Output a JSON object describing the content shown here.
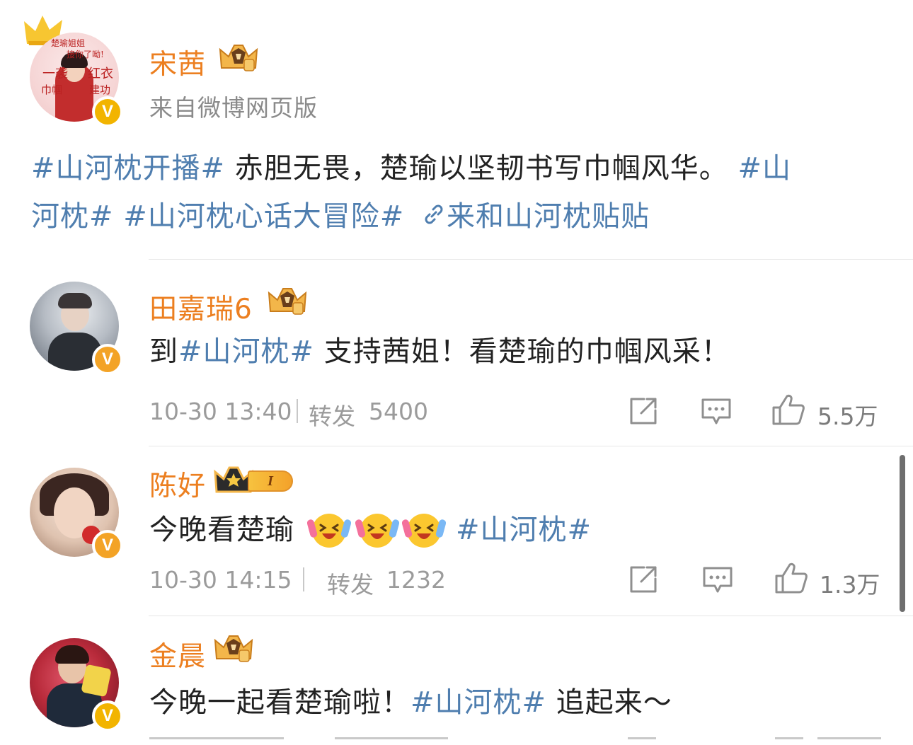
{
  "post": {
    "author": "宋茜",
    "source": "来自微博网页版",
    "line1_tag1": "#山河枕开播#",
    "line1_text": " 赤胆无畏，楚瑜以坚韧书写巾帼风华。",
    "line1_tag2": "#山",
    "line2_tag2": "河枕#",
    "line2_tag3": " #山河枕心话大冒险#",
    "link_text": "来和山河枕贴贴",
    "avatar_texts": [
      "楚瑜姐姐",
      "接你了呦!",
      "一袭",
      "红衣",
      "巾帼",
      "建功"
    ]
  },
  "comments": [
    {
      "author": "田嘉瑞6",
      "pre": "到",
      "tag": "#山河枕#",
      "post": " 支持茜姐！看楚瑜的巾帼风采！",
      "time": "10-30 13:40",
      "repost_label": "转发",
      "repost_count": "5400",
      "like_count": "5.5万"
    },
    {
      "author": "陈好",
      "level": "I",
      "pre": "今晚看楚瑜",
      "tag": "#山河枕#",
      "time": "10-30 14:15",
      "repost_label": "转发",
      "repost_count": "1232",
      "like_count": "1.3万"
    },
    {
      "author": "金晨",
      "pre": "今晚一起看楚瑜啦！",
      "tag": "#山河枕#",
      "post": " 追起来～"
    }
  ],
  "colors": {
    "name": "#ec7f20",
    "link": "#4f7eaf",
    "meta": "#9b9b9b",
    "badge": "#f3a326"
  },
  "icons": [
    "crown-icon",
    "verified-badge-icon",
    "link-icon",
    "repost-icon",
    "comment-icon",
    "like-icon",
    "emoji-icon"
  ]
}
